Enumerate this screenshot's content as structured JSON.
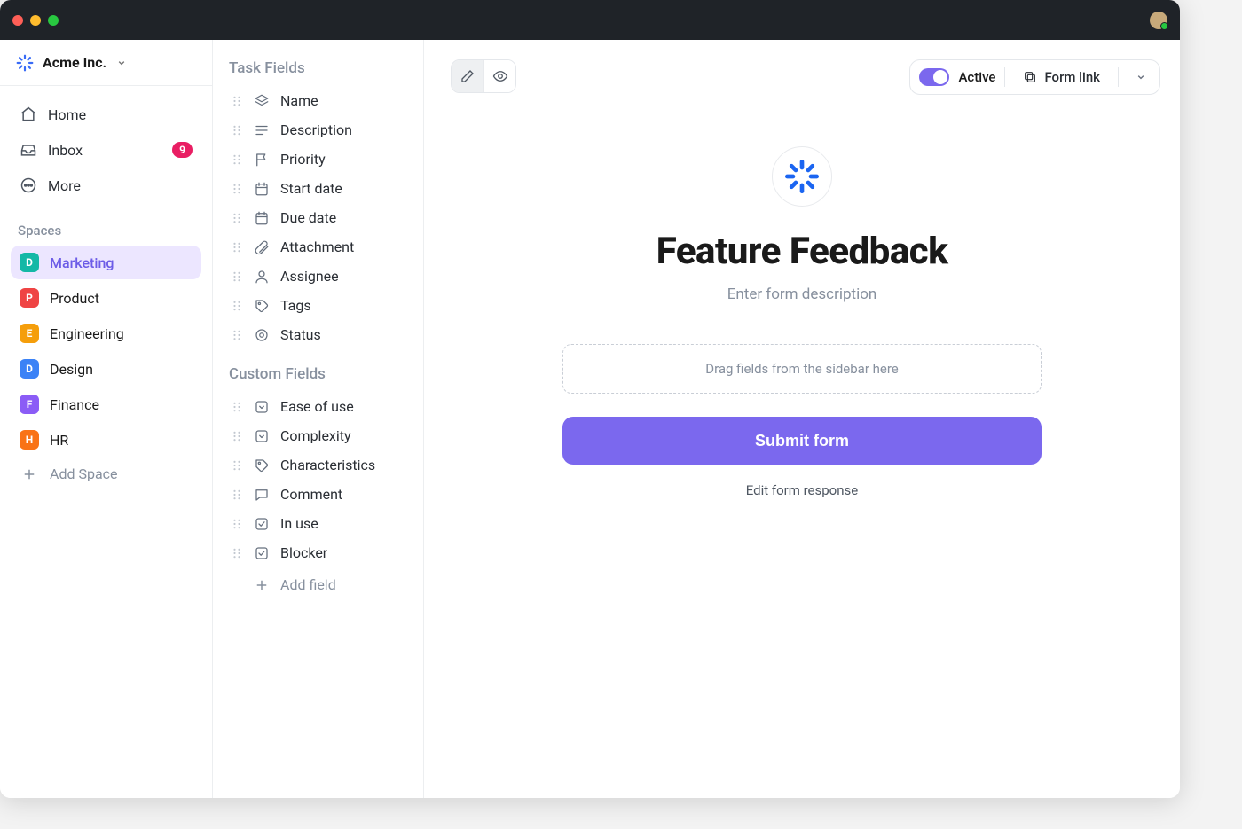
{
  "workspace": {
    "name": "Acme Inc."
  },
  "nav": {
    "home": "Home",
    "inbox": "Inbox",
    "inbox_badge": "9",
    "more": "More"
  },
  "spaces": {
    "heading": "Spaces",
    "items": [
      {
        "letter": "D",
        "color": "#14b8a6",
        "label": "Marketing",
        "active": true
      },
      {
        "letter": "P",
        "color": "#ef4444",
        "label": "Product"
      },
      {
        "letter": "E",
        "color": "#f59e0b",
        "label": "Engineering"
      },
      {
        "letter": "D",
        "color": "#3b82f6",
        "label": "Design"
      },
      {
        "letter": "F",
        "color": "#8b5cf6",
        "label": "Finance"
      },
      {
        "letter": "H",
        "color": "#f97316",
        "label": "HR"
      }
    ],
    "add_label": "Add Space"
  },
  "fields": {
    "task_heading": "Task Fields",
    "task_items": [
      {
        "label": "Name",
        "icon": "layers"
      },
      {
        "label": "Description",
        "icon": "text"
      },
      {
        "label": "Priority",
        "icon": "flag"
      },
      {
        "label": "Start date",
        "icon": "calendar"
      },
      {
        "label": "Due date",
        "icon": "calendar"
      },
      {
        "label": "Attachment",
        "icon": "paperclip"
      },
      {
        "label": "Assignee",
        "icon": "person"
      },
      {
        "label": "Tags",
        "icon": "tag"
      },
      {
        "label": "Status",
        "icon": "target"
      }
    ],
    "custom_heading": "Custom Fields",
    "custom_items": [
      {
        "label": "Ease of use",
        "icon": "dropdown"
      },
      {
        "label": "Complexity",
        "icon": "dropdown"
      },
      {
        "label": "Characteristics",
        "icon": "tag"
      },
      {
        "label": "Comment",
        "icon": "comment"
      },
      {
        "label": "In use",
        "icon": "checkbox"
      },
      {
        "label": "Blocker",
        "icon": "checkbox"
      }
    ],
    "add_field_label": "Add field"
  },
  "form": {
    "status_label": "Active",
    "link_label": "Form link",
    "title": "Feature Feedback",
    "description_placeholder": "Enter form description",
    "dropzone_hint": "Drag fields from the sidebar here",
    "submit_label": "Submit form",
    "edit_response_label": "Edit form response"
  }
}
